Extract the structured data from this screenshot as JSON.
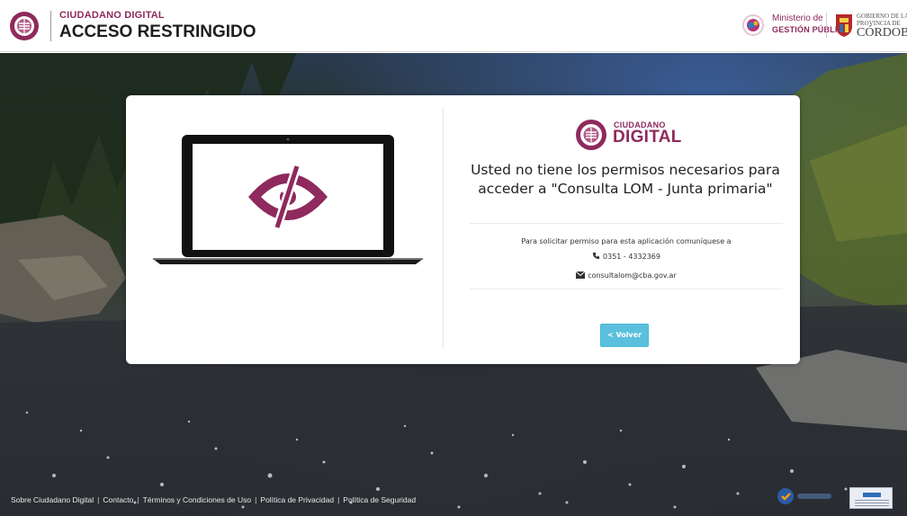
{
  "header": {
    "brand": "CIUDADANO DIGITAL",
    "title": "ACCESO RESTRINGIDO",
    "ministry_line1": "Ministerio de",
    "ministry_line2": "GESTIÓN PÚBLICA",
    "gov_line1": "GOBIERNO DE LA",
    "gov_line2": "PROVINCIA DE",
    "gov_line3": "CÓRDOBA"
  },
  "card": {
    "logo_word1": "CIUDADANO",
    "logo_word2": "DIGITAL",
    "message": "Usted no tiene los permisos necesarios para acceder a \"Consulta LOM - Junta primaria\"",
    "permission_text": "Para solicitar permiso para esta aplicación comuníquese a",
    "phone": "0351 - 4332369",
    "email": "consultalom@cba.gov.ar",
    "back_button": "< Volver"
  },
  "footer": {
    "links": [
      "Sobre Ciudadano Digital",
      "Contacto",
      "Términos y Condiciones de Uso",
      "Política de Privacidad",
      "Política de Seguridad"
    ],
    "separator": "|"
  },
  "colors": {
    "brand": "#8e2a5d",
    "button": "#5bc0de"
  },
  "icons": {
    "restricted": "eye-slash-icon",
    "phone": "phone-icon",
    "email": "envelope-icon"
  }
}
